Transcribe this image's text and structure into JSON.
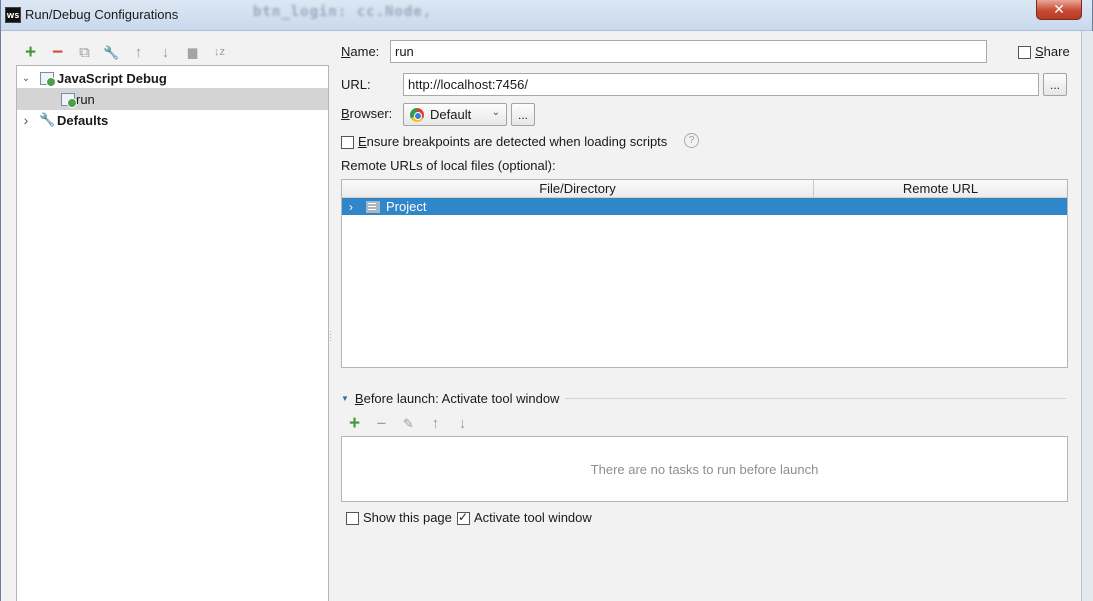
{
  "window": {
    "title": "Run/Debug Configurations",
    "app_icon_text": "WS",
    "background_title_text": "btn_login: cc.Node,",
    "close_glyph": "✕"
  },
  "left_toolbar": {
    "add": "+",
    "remove": "−",
    "copy": "⧉",
    "edit_defaults": "🔧",
    "move_up": "↑",
    "move_down": "↓",
    "folder": "▆",
    "sort": "↓z"
  },
  "tree": {
    "items": [
      {
        "label": "JavaScript Debug",
        "arrow": "⌄",
        "icon": "javascript-debug-icon"
      },
      {
        "label": "run",
        "icon": "run-config-icon"
      },
      {
        "label": "Defaults",
        "arrow": "›",
        "icon": "wrench-icon"
      }
    ]
  },
  "form": {
    "name_label_prefix": "N",
    "name_label_rest": "ame:",
    "name_value": "run",
    "share_label_prefix": "S",
    "share_label_rest": "hare",
    "url_label": "URL:",
    "url_value": "http://localhost:7456/",
    "url_button": "...",
    "browser_label_prefix": "B",
    "browser_label_rest": "rowser:",
    "browser_value": "Default",
    "browser_button": "...",
    "ensure_label_prefix": "E",
    "ensure_label_rest": "nsure breakpoints are detected when loading scripts",
    "help_glyph": "?",
    "remote_urls_label": "Remote URLs of local files (optional):"
  },
  "urls_table": {
    "columns": [
      "File/Directory",
      "Remote URL"
    ],
    "rows": [
      {
        "label": "Project"
      }
    ]
  },
  "before_launch": {
    "title_prefix": "B",
    "title_rest": "efore launch: Activate tool window",
    "toolbar": {
      "add": "+",
      "remove": "−",
      "edit": "✎",
      "up": "↑",
      "down": "↓"
    },
    "empty_text": "There are no tasks to run before launch"
  },
  "footer": {
    "show_page_label": "Show this page",
    "activate_label": "Activate tool window",
    "show_page_checked": false,
    "activate_checked": true
  }
}
